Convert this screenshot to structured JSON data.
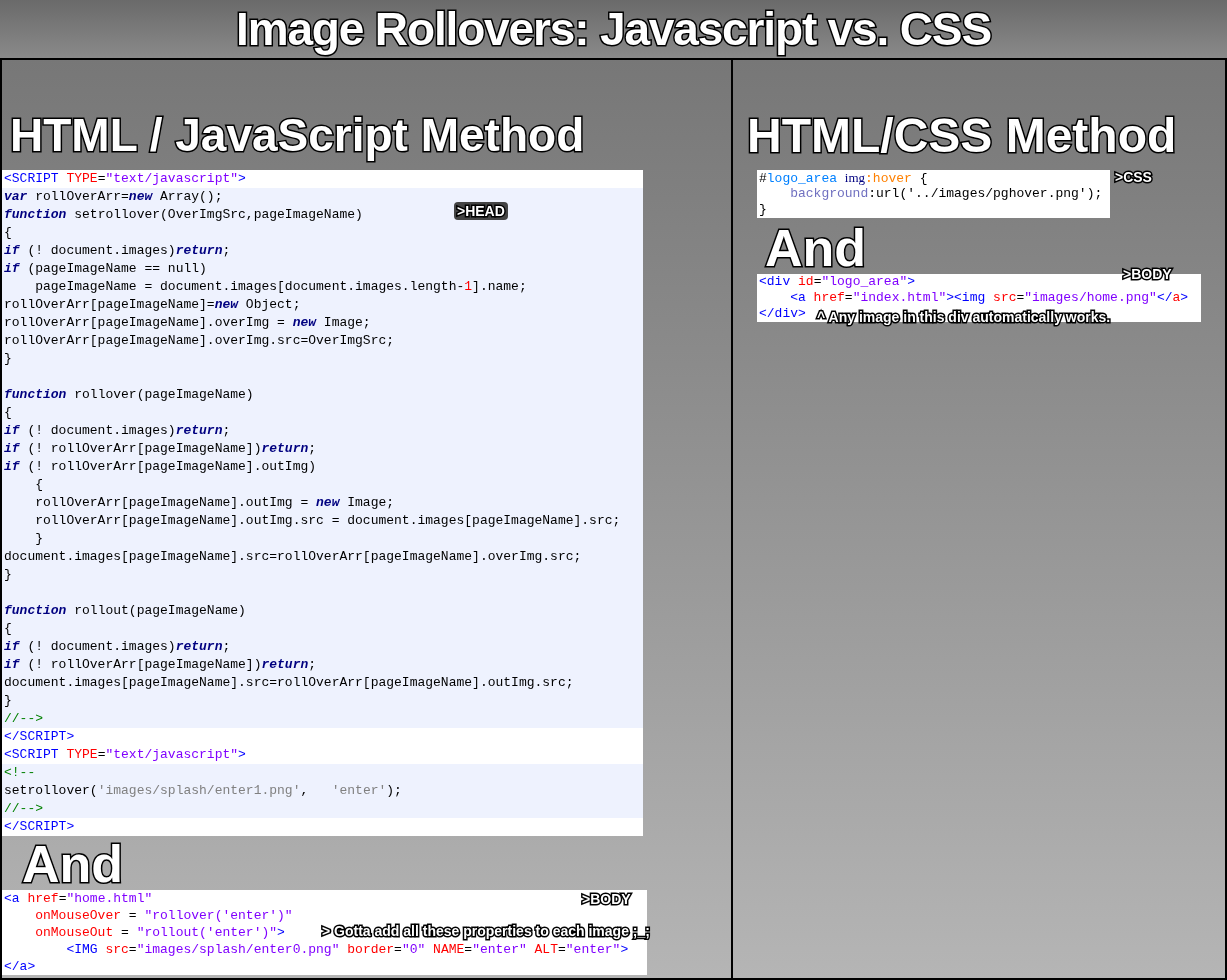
{
  "title": "Image Rollovers: Javascript vs. CSS",
  "left_panel": {
    "heading": "HTML / JavaScript Method",
    "head_code": {
      "tag_note": ">HEAD",
      "lines": [
        {
          "highlighted": false,
          "tokens": [
            {
              "kind": "tag",
              "text": "<SCRIPT "
            },
            {
              "kind": "attr",
              "text": "TYPE"
            },
            {
              "kind": "plain",
              "text": "="
            },
            {
              "kind": "string",
              "text": "\"text/javascript\""
            },
            {
              "kind": "tag",
              "text": ">"
            }
          ]
        },
        {
          "highlighted": true,
          "tokens": [
            {
              "kind": "keyword",
              "text": "var"
            },
            {
              "kind": "plain",
              "text": " rollOverArr="
            },
            {
              "kind": "keyword",
              "text": "new"
            },
            {
              "kind": "plain",
              "text": " Array();"
            }
          ]
        },
        {
          "highlighted": true,
          "tokens": [
            {
              "kind": "keyword",
              "text": "function"
            },
            {
              "kind": "plain",
              "text": " setrollover(OverImgSrc,pageImageName)"
            }
          ]
        },
        {
          "highlighted": true,
          "tokens": [
            {
              "kind": "plain",
              "text": "{"
            }
          ]
        },
        {
          "highlighted": true,
          "tokens": [
            {
              "kind": "keyword",
              "text": "if"
            },
            {
              "kind": "plain",
              "text": " (! document.images)"
            },
            {
              "kind": "keyword",
              "text": "return"
            },
            {
              "kind": "plain",
              "text": ";"
            }
          ]
        },
        {
          "highlighted": true,
          "tokens": [
            {
              "kind": "keyword",
              "text": "if"
            },
            {
              "kind": "plain",
              "text": " (pageImageName == null)"
            }
          ]
        },
        {
          "highlighted": true,
          "tokens": [
            {
              "kind": "plain",
              "text": "    pageImageName = document.images[document.images.length-"
            },
            {
              "kind": "number",
              "text": "1"
            },
            {
              "kind": "plain",
              "text": "].name;"
            }
          ]
        },
        {
          "highlighted": true,
          "tokens": [
            {
              "kind": "plain",
              "text": "rollOverArr[pageImageName]="
            },
            {
              "kind": "keyword",
              "text": "new"
            },
            {
              "kind": "plain",
              "text": " Object;"
            }
          ]
        },
        {
          "highlighted": true,
          "tokens": [
            {
              "kind": "plain",
              "text": "rollOverArr[pageImageName].overImg = "
            },
            {
              "kind": "keyword",
              "text": "new"
            },
            {
              "kind": "plain",
              "text": " Image;"
            }
          ]
        },
        {
          "highlighted": true,
          "tokens": [
            {
              "kind": "plain",
              "text": "rollOverArr[pageImageName].overImg.src=OverImgSrc;"
            }
          ]
        },
        {
          "highlighted": true,
          "tokens": [
            {
              "kind": "plain",
              "text": "}"
            }
          ]
        },
        {
          "highlighted": true
        },
        {
          "highlighted": true,
          "tokens": [
            {
              "kind": "keyword",
              "text": "function"
            },
            {
              "kind": "plain",
              "text": " rollover(pageImageName)"
            }
          ]
        },
        {
          "highlighted": true,
          "tokens": [
            {
              "kind": "plain",
              "text": "{"
            }
          ]
        },
        {
          "highlighted": true,
          "tokens": [
            {
              "kind": "keyword",
              "text": "if"
            },
            {
              "kind": "plain",
              "text": " (! document.images)"
            },
            {
              "kind": "keyword",
              "text": "return"
            },
            {
              "kind": "plain",
              "text": ";"
            }
          ]
        },
        {
          "highlighted": true,
          "tokens": [
            {
              "kind": "keyword",
              "text": "if"
            },
            {
              "kind": "plain",
              "text": " (! rollOverArr[pageImageName])"
            },
            {
              "kind": "keyword",
              "text": "return"
            },
            {
              "kind": "plain",
              "text": ";"
            }
          ]
        },
        {
          "highlighted": true,
          "tokens": [
            {
              "kind": "keyword",
              "text": "if"
            },
            {
              "kind": "plain",
              "text": " (! rollOverArr[pageImageName].outImg)"
            }
          ]
        },
        {
          "highlighted": true,
          "tokens": [
            {
              "kind": "plain",
              "text": "    {"
            }
          ]
        },
        {
          "highlighted": true,
          "tokens": [
            {
              "kind": "plain",
              "text": "    rollOverArr[pageImageName].outImg = "
            },
            {
              "kind": "keyword",
              "text": "new"
            },
            {
              "kind": "plain",
              "text": " Image;"
            }
          ]
        },
        {
          "highlighted": true,
          "tokens": [
            {
              "kind": "plain",
              "text": "    rollOverArr[pageImageName].outImg.src = document.images[pageImageName].src;"
            }
          ]
        },
        {
          "highlighted": true,
          "tokens": [
            {
              "kind": "plain",
              "text": "    }"
            }
          ]
        },
        {
          "highlighted": true,
          "tokens": [
            {
              "kind": "plain",
              "text": "document.images[pageImageName].src=rollOverArr[pageImageName].overImg.src;"
            }
          ]
        },
        {
          "highlighted": true,
          "tokens": [
            {
              "kind": "plain",
              "text": "}"
            }
          ]
        },
        {
          "highlighted": true
        },
        {
          "highlighted": true,
          "tokens": [
            {
              "kind": "keyword",
              "text": "function"
            },
            {
              "kind": "plain",
              "text": " rollout(pageImageName)"
            }
          ]
        },
        {
          "highlighted": true,
          "tokens": [
            {
              "kind": "plain",
              "text": "{"
            }
          ]
        },
        {
          "highlighted": true,
          "tokens": [
            {
              "kind": "keyword",
              "text": "if"
            },
            {
              "kind": "plain",
              "text": " (! document.images)"
            },
            {
              "kind": "keyword",
              "text": "return"
            },
            {
              "kind": "plain",
              "text": ";"
            }
          ]
        },
        {
          "highlighted": true,
          "tokens": [
            {
              "kind": "keyword",
              "text": "if"
            },
            {
              "kind": "plain",
              "text": " (! rollOverArr[pageImageName])"
            },
            {
              "kind": "keyword",
              "text": "return"
            },
            {
              "kind": "plain",
              "text": ";"
            }
          ]
        },
        {
          "highlighted": true,
          "tokens": [
            {
              "kind": "plain",
              "text": "document.images[pageImageName].src=rollOverArr[pageImageName].outImg.src;"
            }
          ]
        },
        {
          "highlighted": true,
          "tokens": [
            {
              "kind": "plain",
              "text": "}"
            }
          ]
        },
        {
          "highlighted": true,
          "tokens": [
            {
              "kind": "comment",
              "text": "//-->"
            }
          ]
        },
        {
          "highlighted": false,
          "tokens": [
            {
              "kind": "tag",
              "text": "</SCRIPT>"
            }
          ]
        },
        {
          "highlighted": false,
          "tokens": [
            {
              "kind": "tag",
              "text": "<SCRIPT "
            },
            {
              "kind": "attr",
              "text": "TYPE"
            },
            {
              "kind": "plain",
              "text": "="
            },
            {
              "kind": "string",
              "text": "\"text/javascript\""
            },
            {
              "kind": "tag",
              "text": ">"
            }
          ]
        },
        {
          "highlighted": true,
          "tokens": [
            {
              "kind": "comment",
              "text": "<!--"
            }
          ]
        },
        {
          "highlighted": true,
          "tokens": [
            {
              "kind": "plain",
              "text": "setrollover("
            },
            {
              "kind": "quote",
              "text": "'images/splash/enter1.png'"
            },
            {
              "kind": "plain",
              "text": ",   "
            },
            {
              "kind": "quote",
              "text": "'enter'"
            },
            {
              "kind": "plain",
              "text": ");"
            }
          ]
        },
        {
          "highlighted": true,
          "tokens": [
            {
              "kind": "comment",
              "text": "//-->"
            }
          ]
        },
        {
          "highlighted": false,
          "tokens": [
            {
              "kind": "tag",
              "text": "</SCRIPT>"
            }
          ]
        }
      ]
    },
    "and_label": "And",
    "body_code": {
      "tag_note": ">BODY",
      "comment": "> Gotta add all these properties to each image ;_;",
      "lines": [
        {
          "tokens": [
            {
              "kind": "tag",
              "text": "<a "
            },
            {
              "kind": "attr",
              "text": "href"
            },
            {
              "kind": "plain",
              "text": "="
            },
            {
              "kind": "string",
              "text": "\"home.html\""
            }
          ]
        },
        {
          "tokens": [
            {
              "kind": "attr",
              "text": "    onMouseOver"
            },
            {
              "kind": "plain",
              "text": " = "
            },
            {
              "kind": "string",
              "text": "\"rollover('enter')\""
            }
          ]
        },
        {
          "tokens": [
            {
              "kind": "attr",
              "text": "    onMouseOut"
            },
            {
              "kind": "plain",
              "text": " = "
            },
            {
              "kind": "string",
              "text": "\"rollout('enter')\""
            },
            {
              "kind": "tag",
              "text": ">"
            }
          ]
        },
        {
          "tokens": [
            {
              "kind": "tag",
              "text": "        <IMG "
            },
            {
              "kind": "attr",
              "text": "src"
            },
            {
              "kind": "plain",
              "text": "="
            },
            {
              "kind": "string",
              "text": "\"images/splash/enter0.png\""
            },
            {
              "kind": "attr",
              "text": " border"
            },
            {
              "kind": "plain",
              "text": "="
            },
            {
              "kind": "string",
              "text": "\"0\""
            },
            {
              "kind": "attr",
              "text": " NAME"
            },
            {
              "kind": "plain",
              "text": "="
            },
            {
              "kind": "string",
              "text": "\"enter\""
            },
            {
              "kind": "attr",
              "text": " ALT"
            },
            {
              "kind": "plain",
              "text": "="
            },
            {
              "kind": "string",
              "text": "\"enter\""
            },
            {
              "kind": "tag",
              "text": ">"
            }
          ]
        },
        {
          "tokens": [
            {
              "kind": "tag",
              "text": "</a>"
            }
          ]
        }
      ]
    }
  },
  "right_panel": {
    "heading": "HTML/CSS Method",
    "css_code": {
      "tag_note": ">CSS",
      "lines": [
        {
          "tokens": [
            {
              "kind": "plain",
              "text": "#"
            },
            {
              "kind": "id",
              "text": "logo_area "
            },
            {
              "kind": "element",
              "text": "img"
            },
            {
              "kind": "pseudo",
              "text": ":hover"
            },
            {
              "kind": "plain",
              "text": " {"
            }
          ]
        },
        {
          "tokens": [
            {
              "kind": "property",
              "text": "    background"
            },
            {
              "kind": "plain",
              "text": ":url('../images/pghover.png');"
            }
          ]
        },
        {
          "tokens": [
            {
              "kind": "plain",
              "text": "}"
            }
          ]
        }
      ]
    },
    "and_label": "And",
    "body_code": {
      "tag_note": ">BODY",
      "comment": "^ Any image in this div automatically works.",
      "lines": [
        {
          "tokens": [
            {
              "kind": "tag",
              "text": "<div "
            },
            {
              "kind": "attr",
              "text": "id"
            },
            {
              "kind": "plain",
              "text": "="
            },
            {
              "kind": "string",
              "text": "\"logo_area\""
            },
            {
              "kind": "tag",
              "text": ">"
            }
          ]
        },
        {
          "tokens": [
            {
              "kind": "tag",
              "text": "    <a "
            },
            {
              "kind": "attr",
              "text": "href"
            },
            {
              "kind": "plain",
              "text": "="
            },
            {
              "kind": "string",
              "text": "\"index.html\""
            },
            {
              "kind": "tag",
              "text": "><img "
            },
            {
              "kind": "attr",
              "text": "src"
            },
            {
              "kind": "plain",
              "text": "="
            },
            {
              "kind": "string",
              "text": "\"images/home.png\""
            },
            {
              "kind": "tag",
              "text": "</"
            },
            {
              "kind": "attr",
              "text": "a"
            },
            {
              "kind": "tag",
              "text": ">"
            }
          ]
        },
        {
          "tokens": [
            {
              "kind": "tag",
              "text": "</div>"
            }
          ]
        }
      ]
    }
  }
}
